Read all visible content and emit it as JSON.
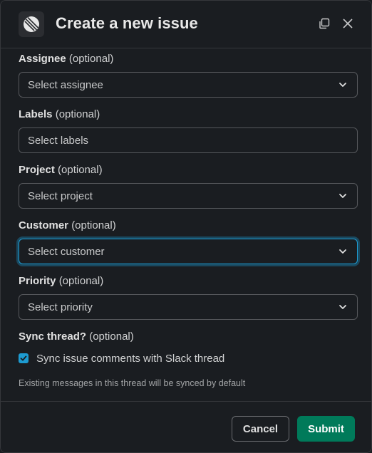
{
  "header": {
    "title": "Create a new issue"
  },
  "form": {
    "assignee": {
      "label": "Assignee",
      "suffix": "(optional)",
      "placeholder": "Select assignee"
    },
    "labels": {
      "label": "Labels",
      "suffix": "(optional)",
      "placeholder": "Select labels"
    },
    "project": {
      "label": "Project",
      "suffix": "(optional)",
      "placeholder": "Select project"
    },
    "customer": {
      "label": "Customer",
      "suffix": "(optional)",
      "placeholder": "Select customer"
    },
    "priority": {
      "label": "Priority",
      "suffix": "(optional)",
      "placeholder": "Select priority"
    },
    "sync": {
      "label": "Sync thread?",
      "suffix": "(optional)",
      "checkbox_label": "Sync issue comments with Slack thread",
      "checked": true,
      "hint": "Existing messages in this thread will be synced by default"
    }
  },
  "footer": {
    "cancel_label": "Cancel",
    "submit_label": "Submit"
  },
  "colors": {
    "accent": "#1d9bd1",
    "submit": "#007a5a",
    "background": "#1a1d21"
  },
  "icons": {
    "logo": "linear-logo-icon",
    "expand": "expand-window-icon",
    "close": "close-icon",
    "chevron": "chevron-down-icon",
    "check": "check-icon"
  }
}
